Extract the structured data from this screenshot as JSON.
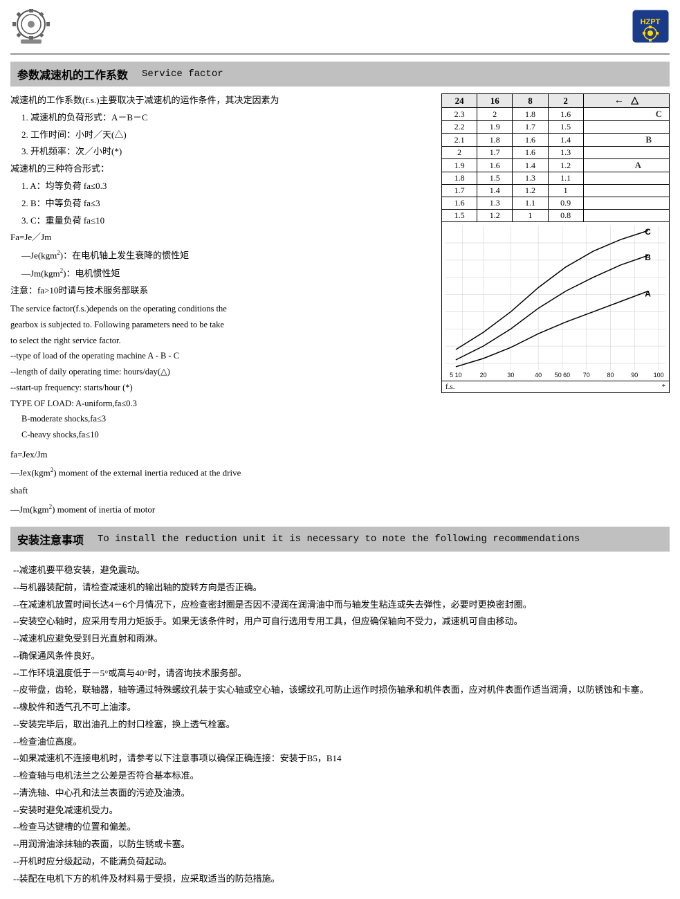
{
  "header": {
    "title_left": "参数减速机的工作系数",
    "title_right": "Service factor"
  },
  "section1": {
    "zh_label": "参数减速机的工作系数",
    "en_label": "Service factor",
    "zh_content": [
      "减速机的工作系数(f.s.)主要取决于减速机的运作条件，其决定因素为",
      "1.  减速机的负荷形式：A－B－C",
      "2.  工作时间：小时／天(△)",
      "3.  开机频率：次／小时(*)",
      "减速机的三种符合形式：",
      "1.  A：均等负荷 fa≤0.3",
      "2.  B：中等负荷 fa≤3",
      "3.  C：重量负荷 fa≤10",
      "Fa=Je／Jm",
      "   —Je(kgm²)：在电机轴上发生衰降的惯性矩",
      "   —Jm(kgm²)：电机惯性矩",
      "注意：fa>10时请与技术服务部联系"
    ],
    "en_content": [
      "The service factor(f.s.)depends on the operating conditions the",
      "gearbox is subjected to. Following parameters need to be take",
      "to select the right service factor.",
      "   --type of load of the operating machine A - B - C",
      "   --length of daily operating time: hours/day(△)",
      "   --start-up frequency: starts/hour (*)",
      "TYPE OF LOAD:  A-uniform,fa≤0.3",
      "               B-moderate shocks,fa≤3",
      "               C-heavy shocks,fa≤10"
    ],
    "fa_content": [
      "fa=Jex/Jm",
      "—Jex(kgm²) moment of the external inertia reduced at the drive",
      "shaft",
      "—Jm(kgm²) moment of inertia of motor"
    ]
  },
  "chart": {
    "col_headers": [
      "24",
      "16",
      "8",
      "2"
    ],
    "rows": [
      [
        "2.3",
        "2",
        "1.8",
        "1.6"
      ],
      [
        "2.2",
        "1.9",
        "1.7",
        "1.5"
      ],
      [
        "2.1",
        "1.8",
        "1.6",
        "1.4"
      ],
      [
        "2",
        "1.7",
        "1.6",
        "1.3"
      ],
      [
        "1.9",
        "1.6",
        "1.4",
        "1.2"
      ],
      [
        "1.8",
        "1.5",
        "1.3",
        "1.1"
      ],
      [
        "1.7",
        "1.4",
        "1.2",
        "1"
      ],
      [
        "1.6",
        "1.3",
        "1.1",
        "0.9"
      ],
      [
        "1.5",
        "1.2",
        "1",
        "0.8"
      ]
    ],
    "x_labels": [
      "5 10",
      "20",
      "30",
      "40",
      "50 60",
      "70",
      "80",
      "90",
      "100"
    ],
    "bottom_label_left": "f.s.",
    "bottom_label_right": "*",
    "curves": [
      "C",
      "B",
      "A"
    ],
    "arrow_label": "△"
  },
  "section2": {
    "zh_label": "安装注意事项",
    "en_label": "To install the reduction unit it is necessary to note the following recommendations",
    "items": [
      "--减速机要平稳安装，避免震动。",
      "--与机器装配前，请检查减速机的输出轴的旋转方向是否正确。",
      "--在减速机放置时间长达4－6个月情况下，应检查密封圈是否因不浸润在润滑油中而与轴发生粘连或失去弹性，必要时更换密封圈。",
      "--安装空心轴时，应采用专用力矩扳手。如果无该条件时，用户可自行选用专用工具，但应确保轴向不受力，减速机可自由移动。",
      "--减速机应避免受到日光直射和雨淋。",
      "--确保通风条件良好。",
      "--工作环境温度低于－5°或高与40°时，请咨询技术服务部。",
      "--皮带盘，齿轮，联轴器，轴等通过特殊螺纹孔装于实心轴或空心轴，该螺纹孔可防止运作时损伤轴承和机件表面，应对机件表面作适当润滑，以防锈蚀和卡塞。",
      "--橡胶件和透气孔不可上油漆。",
      "--安装完毕后，取出油孔上的封口栓塞，换上透气栓塞。",
      "--检查油位高度。",
      "--如果减速机不连接电机时，请参考以下注意事项以确保正确连接：安装于B5，B14",
      "--检查轴与电机法兰之公差是否符合基本标准。",
      "--清洗轴、中心孔和法兰表面的污迹及油渍。",
      "--安装时避免减速机受力。",
      "--检查马达键槽的位置和偏差。",
      "--用润滑油涂抹轴的表面，以防生锈或卡塞。",
      "--开机时应分级起动，不能满负荷起动。",
      "--装配在电机下方的机件及材料易于受损，应采取适当的防范措施。"
    ]
  }
}
